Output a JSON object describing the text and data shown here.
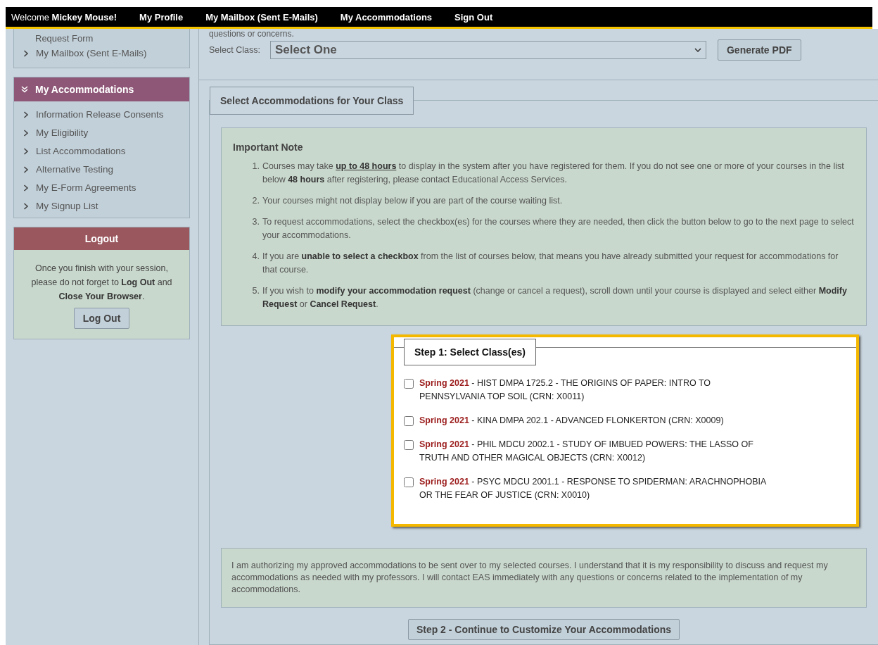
{
  "nav": [
    {
      "label": "Welcome **Mickey Mouse!**"
    },
    {
      "label": "My Profile"
    },
    {
      "label": "My Mailbox (Sent E-Mails)"
    },
    {
      "label": "My Accommodations"
    },
    {
      "label": "Sign Out"
    }
  ],
  "sidebar": {
    "top_box": {
      "cut_text": "Request Form",
      "items": [
        {
          "label": "My Mailbox (Sent E-Mails)"
        }
      ]
    },
    "accommodations": {
      "title": "My Accommodations",
      "expanded": true,
      "items": [
        {
          "label": "Information Release Consents"
        },
        {
          "label": "My Eligibility"
        },
        {
          "label": "List Accommodations"
        },
        {
          "label": "Alternative Testing"
        },
        {
          "label": "My E-Form Agreements"
        },
        {
          "label": "My Signup List"
        }
      ]
    },
    "logout": {
      "title": "Logout",
      "message": "Once you finish with your session, please do not forget to **Log Out** and **Close Your Browser**.",
      "button": "Log Out"
    }
  },
  "main": {
    "cut_text": "questions or concerns.",
    "select_label": "Select Class:",
    "select_value": "Select One",
    "generate_button": "Generate PDF",
    "section": {
      "legend": "Select Accommodations for Your Class",
      "note_title": "Important Note",
      "notes": [
        {
          "marker": "1.",
          "text": "Courses may take **up to 48 hours** to display in the system after you have registered for them. If you do not see one or more of your courses in the list below **48 hours** after registering, please contact Educational Access Services."
        },
        {
          "marker": "2.",
          "text": "Your courses might not display below if you are part of the course waiting list."
        },
        {
          "marker": "3.",
          "text": "To request accommodations, select the checkbox(es) for the courses where they are needed, then click the button below to go to the next page to select your accommodations."
        },
        {
          "marker": "4.",
          "text": "If you are **unable to select a checkbox** from the list of courses below, that means you have already submitted your request for accommodations for that course."
        },
        {
          "marker": "5.",
          "text": "If you wish to **modify your accommodation request** (change or cancel a request), scroll down until your course is displayed and select either **Modify Request** or **Cancel Request**."
        }
      ],
      "step1": {
        "legend": "Step 1: Select Class(es)",
        "courses": [
          {
            "term": "Spring 2021",
            "description": " - HIST DMPA 1725.2 - THE ORIGINS OF PAPER: INTRO TO PENNSYLVANIA TOP SOIL (CRN: X0011)",
            "checked": false
          },
          {
            "term": "Spring 2021",
            "description": " - KINA DMPA 202.1 - ADVANCED FLONKERTON (CRN: X0009)",
            "checked": false
          },
          {
            "term": "Spring 2021",
            "description": " - PHIL MDCU 2002.1 - STUDY OF IMBUED POWERS: THE LASSO OF TRUTH AND OTHER MAGICAL OBJECTS (CRN: X0012)",
            "checked": false
          },
          {
            "term": "Spring 2021",
            "description": " - PSYC MDCU 2001.1 - RESPONSE TO SPIDERMAN: ARACHNOPHOBIA OR THE FEAR OF JUSTICE (CRN: X0010)",
            "checked": false
          }
        ]
      },
      "authorization": "I am authorizing my approved accommodations to be sent over to my selected courses. I understand that it is my responsibility to discuss and request my accommodations as needed with my professors. I will contact EAS immediately with any questions or concerns related to the implementation of my accommodations.",
      "step2_button": "Step 2 - Continue to Customize Your Accommodations"
    }
  }
}
